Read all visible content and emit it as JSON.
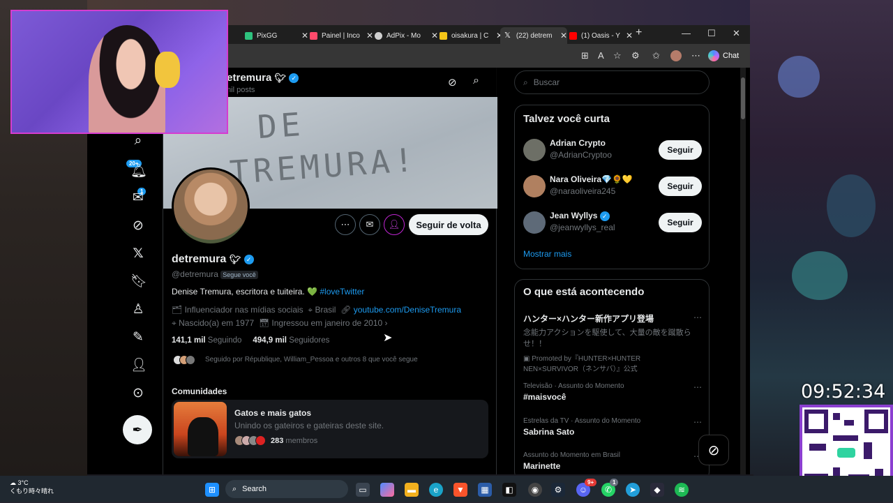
{
  "browser": {
    "tabs": [
      {
        "label": "PixGG",
        "color": "#2ec27e",
        "active": false
      },
      {
        "label": "Painel | Inco",
        "color": "#ff4a6b",
        "active": false
      },
      {
        "label": "AdPix - Mo",
        "color": "#cfcfcf",
        "active": false
      },
      {
        "label": "oisakura | C",
        "color": "#f5c518",
        "active": false
      },
      {
        "label": "(22) detrem",
        "color": "#ffffff",
        "active": true
      },
      {
        "label": "(1) Oasis - Y",
        "color": "#ff0000",
        "active": false
      }
    ],
    "new_tab": "+",
    "chat_label": "Chat"
  },
  "profile": {
    "header_name": "detremura",
    "header_sub": "mil posts",
    "banner_text_1": "DE",
    "banner_text_2": "TREMURA!",
    "name": "detremura",
    "handle": "@detremura",
    "follows_you": "Segue você",
    "bio_text": "Denise Tremura, escritora e tuiteira. 💚",
    "bio_hashtag": "#loveTwitter",
    "category": "Influenciador nas mídias sociais",
    "location": "Brasil",
    "website": "youtube.com/DeniseTremura",
    "born": "Nascido(a) em 1977",
    "joined": "Ingressou em janeiro de 2010",
    "following_count": "141,1 mil",
    "following_label": "Seguindo",
    "followers_count": "494,9 mil",
    "followers_label": "Seguidores",
    "followed_by": "Seguido por République, William_Pessoa e outros 8 que você segue",
    "follow_back": "Seguir de volta",
    "communities_title": "Comunidades",
    "community": {
      "name": "Gatos e mais gatos",
      "desc": "Unindo os gateiros e gateiras deste site.",
      "members_count": "283",
      "members_label": "membros"
    }
  },
  "nav": {
    "notif_badge": "20+",
    "msg_badge": "1"
  },
  "right": {
    "search_placeholder": "Buscar",
    "suggest_title": "Talvez você curta",
    "suggestions": [
      {
        "name": "Adrian Crypto",
        "handle": "@AdrianCryptoo",
        "button": "Seguir",
        "avatar": "#6d6f66"
      },
      {
        "name": "Nara Oliveira💎🌻💛",
        "handle": "@naraoliveira245",
        "button": "Seguir",
        "avatar": "#b08060"
      },
      {
        "name": "Jean Wyllys",
        "handle": "@jeanwyllys_real",
        "button": "Seguir",
        "avatar": "#5e6a78"
      }
    ],
    "show_more": "Mostrar mais",
    "trends_title": "O que está acontecendo",
    "promo": {
      "title": "ハンター×ハンター新作アプリ登場",
      "body": "念能力アクションを駆使して、大量の敵を蹴散らせ！！",
      "by": "Promoted by『HUNTER×HUNTER NEN×SURVIVOR（ネンサバ）』公式"
    },
    "trends": [
      {
        "meta": "Televisão · Assunto do Momento",
        "title": "#maisvocê"
      },
      {
        "meta": "Estrelas da TV · Assunto do Momento",
        "title": "Sabrina Sato"
      },
      {
        "meta": "Assunto do Momento em Brasil",
        "title": "Marinette"
      }
    ]
  },
  "overlay": {
    "clock": "09:52:34"
  },
  "taskbar": {
    "temp": "3°C",
    "weather": "くもり時々晴れ",
    "search": "Search",
    "whatsapp_badge": "1",
    "discord_badge": "9+"
  }
}
